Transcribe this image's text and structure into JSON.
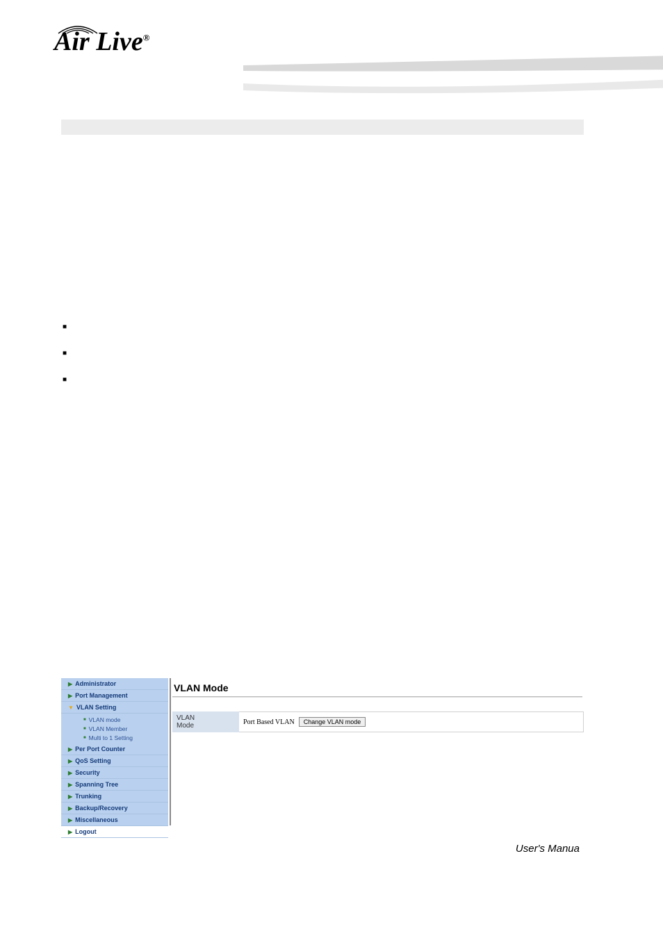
{
  "brand": {
    "name": "Air Live",
    "registered": "®"
  },
  "footer": {
    "text": "User's Manua"
  },
  "sidebar": {
    "items": [
      {
        "label": "Administrator",
        "open": false
      },
      {
        "label": "Port Management",
        "open": false
      },
      {
        "label": "VLAN Setting",
        "open": true,
        "children": [
          {
            "label": "VLAN mode"
          },
          {
            "label": "VLAN Member"
          },
          {
            "label": "Multi to 1 Setting"
          }
        ]
      },
      {
        "label": "Per Port Counter",
        "open": false
      },
      {
        "label": "QoS Setting",
        "open": false
      },
      {
        "label": "Security",
        "open": false
      },
      {
        "label": "Spanning Tree",
        "open": false
      },
      {
        "label": "Trunking",
        "open": false
      },
      {
        "label": "Backup/Recovery",
        "open": false
      },
      {
        "label": "Miscellaneous",
        "open": false
      },
      {
        "label": "Logout",
        "open": false
      }
    ]
  },
  "main": {
    "title": "VLAN Mode",
    "field_label_line1": "VLAN",
    "field_label_line2": "Mode",
    "field_value": "Port Based VLAN",
    "button_label": "Change VLAN mode"
  }
}
